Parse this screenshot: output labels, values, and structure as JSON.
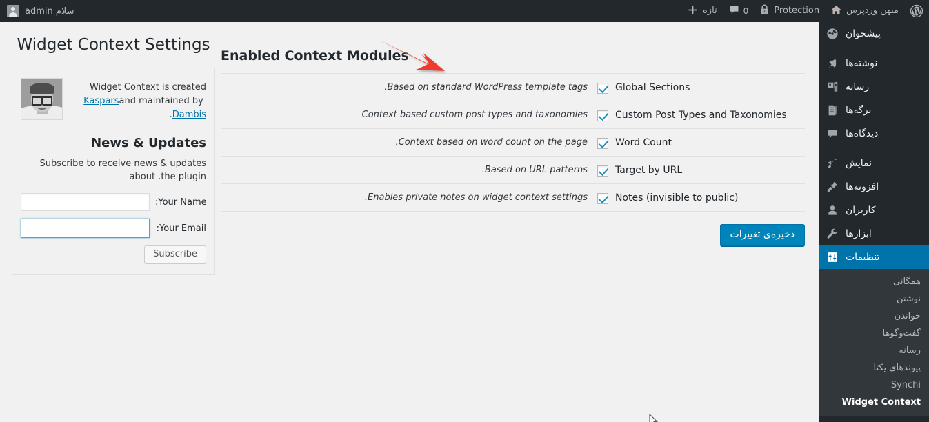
{
  "adminbar": {
    "wp_logo_icon": "wordpress-logo-icon",
    "site_name": "میهن وردپرس",
    "site_home_icon": "home-icon",
    "protection_label": "Protection",
    "protection_icon": "lock-icon",
    "comments_count": "0",
    "comments_icon": "comment-bubble-icon",
    "new_icon": "plus-icon",
    "new_label": "تازه",
    "user_greeting": "سلام admin",
    "user_avatar_icon": "user-avatar-icon"
  },
  "sidebar": {
    "items": [
      {
        "label": "پیشخوان",
        "icon": "dashboard-gauge-icon",
        "current": false,
        "spacer": false
      },
      {
        "label": "نوشته‌ها",
        "icon": "pin-icon",
        "current": false,
        "spacer": true
      },
      {
        "label": "رسانه",
        "icon": "media-icon",
        "current": false,
        "spacer": false
      },
      {
        "label": "برگه‌ها",
        "icon": "pages-icon",
        "current": false,
        "spacer": false
      },
      {
        "label": "دیدگاه‌ها",
        "icon": "comment-icon",
        "current": false,
        "spacer": false
      },
      {
        "label": "نمایش",
        "icon": "appearance-brush-icon",
        "current": false,
        "spacer": true
      },
      {
        "label": "افزونه‌ها",
        "icon": "plugin-plug-icon",
        "current": false,
        "spacer": false
      },
      {
        "label": "کاربران",
        "icon": "users-icon",
        "current": false,
        "spacer": false
      },
      {
        "label": "ابزارها",
        "icon": "tools-wrench-icon",
        "current": false,
        "spacer": false
      },
      {
        "label": "تنظیمات",
        "icon": "settings-sliders-icon",
        "current": true,
        "spacer": false
      }
    ],
    "submenu": [
      {
        "label": "همگانی",
        "active": false
      },
      {
        "label": "نوشتن",
        "active": false
      },
      {
        "label": "خواندن",
        "active": false
      },
      {
        "label": "گفت‌وگوها",
        "active": false
      },
      {
        "label": "رسانه",
        "active": false
      },
      {
        "label": "پیوندهای یکتا",
        "active": false
      },
      {
        "label": "Synchi",
        "active": false
      },
      {
        "label": "Widget Context",
        "active": true
      }
    ]
  },
  "main": {
    "section_title": "Enabled Context Modules",
    "save_button": "ذخیره‌ی تغییرات",
    "modules": [
      {
        "name": "Global Sections",
        "checked": true,
        "description": ".Based on standard WordPress template tags"
      },
      {
        "name": "Custom Post Types and Taxonomies",
        "checked": true,
        "description": "Context based custom post types and taxonomies"
      },
      {
        "name": "Word Count",
        "checked": true,
        "description": ".Context based on word count on the page"
      },
      {
        "name": "Target by URL",
        "checked": true,
        "description": ".Based on URL patterns"
      },
      {
        "name": "(Notes (invisible to public",
        "checked": true,
        "description": ".Enables private notes on widget context settings"
      }
    ]
  },
  "infobox": {
    "panel_title": "Widget Context Settings",
    "author_photo": "author-portrait-photo",
    "author_text_before": "Widget Context is created and maintained by ",
    "author_link": "Kaspars Dambis",
    "author_text_after": ".",
    "news_title": "News & Updates",
    "news_description": "Subscribe to receive news & updates about .the plugin",
    "name_label": ":Your Name",
    "name_value": "",
    "name_placeholder": "",
    "email_label": ":Your Email",
    "email_value": "",
    "email_placeholder": "",
    "subscribe_button": "Subscribe"
  },
  "annotation": {
    "arrow_color": "#ee3b2d",
    "arrow_name": "red-pointer-arrow"
  },
  "colors": {
    "admin_bar_bg": "#23282d",
    "sidebar_bg": "#23282d",
    "submenu_bg": "#32373c",
    "active_menu_bg": "#0073aa",
    "primary_button_bg": "#0085ba",
    "link_blue": "#0073aa",
    "page_bg": "#f1f1f1",
    "checkbox_tick": "#1e8cbe"
  }
}
